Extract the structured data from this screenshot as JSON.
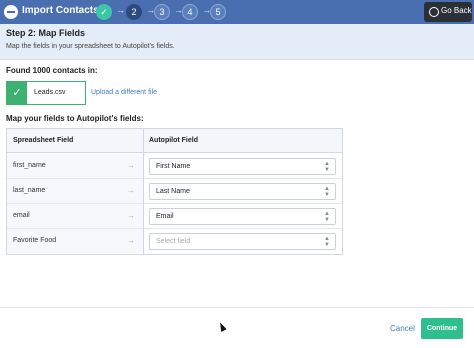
{
  "header": {
    "title": "Import Contacts",
    "title_icon": "minus-circle-icon",
    "steps": [
      {
        "label": "✓",
        "state": "done"
      },
      {
        "label": "2",
        "state": "current"
      },
      {
        "label": "3",
        "state": "todo"
      },
      {
        "label": "4",
        "state": "todo"
      },
      {
        "label": "5",
        "state": "todo"
      }
    ],
    "step_arrow": "→",
    "go_back_label": "Go Back",
    "go_back_icon": "back-circle-icon",
    "background_color": "#4a6fb0"
  },
  "banner": {
    "title": "Step 2: Map Fields",
    "subtitle": "Map the fields in your spreadsheet to Autopilot's fields."
  },
  "import": {
    "found_text": "Found 1000 contacts in:",
    "file_name": "Leads.csv",
    "file_status_icon": "checkmark-icon",
    "upload_link": "Upload a different file"
  },
  "mapping": {
    "heading": "Map your fields to Autopilot's fields:",
    "col_spreadsheet": "Spreadsheet Field",
    "col_autopilot": "Autopilot Field",
    "rows": [
      {
        "field": "first_name",
        "arrow": "→",
        "value": "First Name",
        "placeholder": false
      },
      {
        "field": "last_name",
        "arrow": "→",
        "value": "Last Name",
        "placeholder": false
      },
      {
        "field": "email",
        "arrow": "→",
        "value": "Email",
        "placeholder": false
      },
      {
        "field": "Favorite Food",
        "arrow": "→",
        "value": "Select field",
        "placeholder": true
      }
    ]
  },
  "footer": {
    "cancel_label": "Cancel",
    "continue_label": "Continue",
    "continue_color": "#2fbf8f"
  }
}
